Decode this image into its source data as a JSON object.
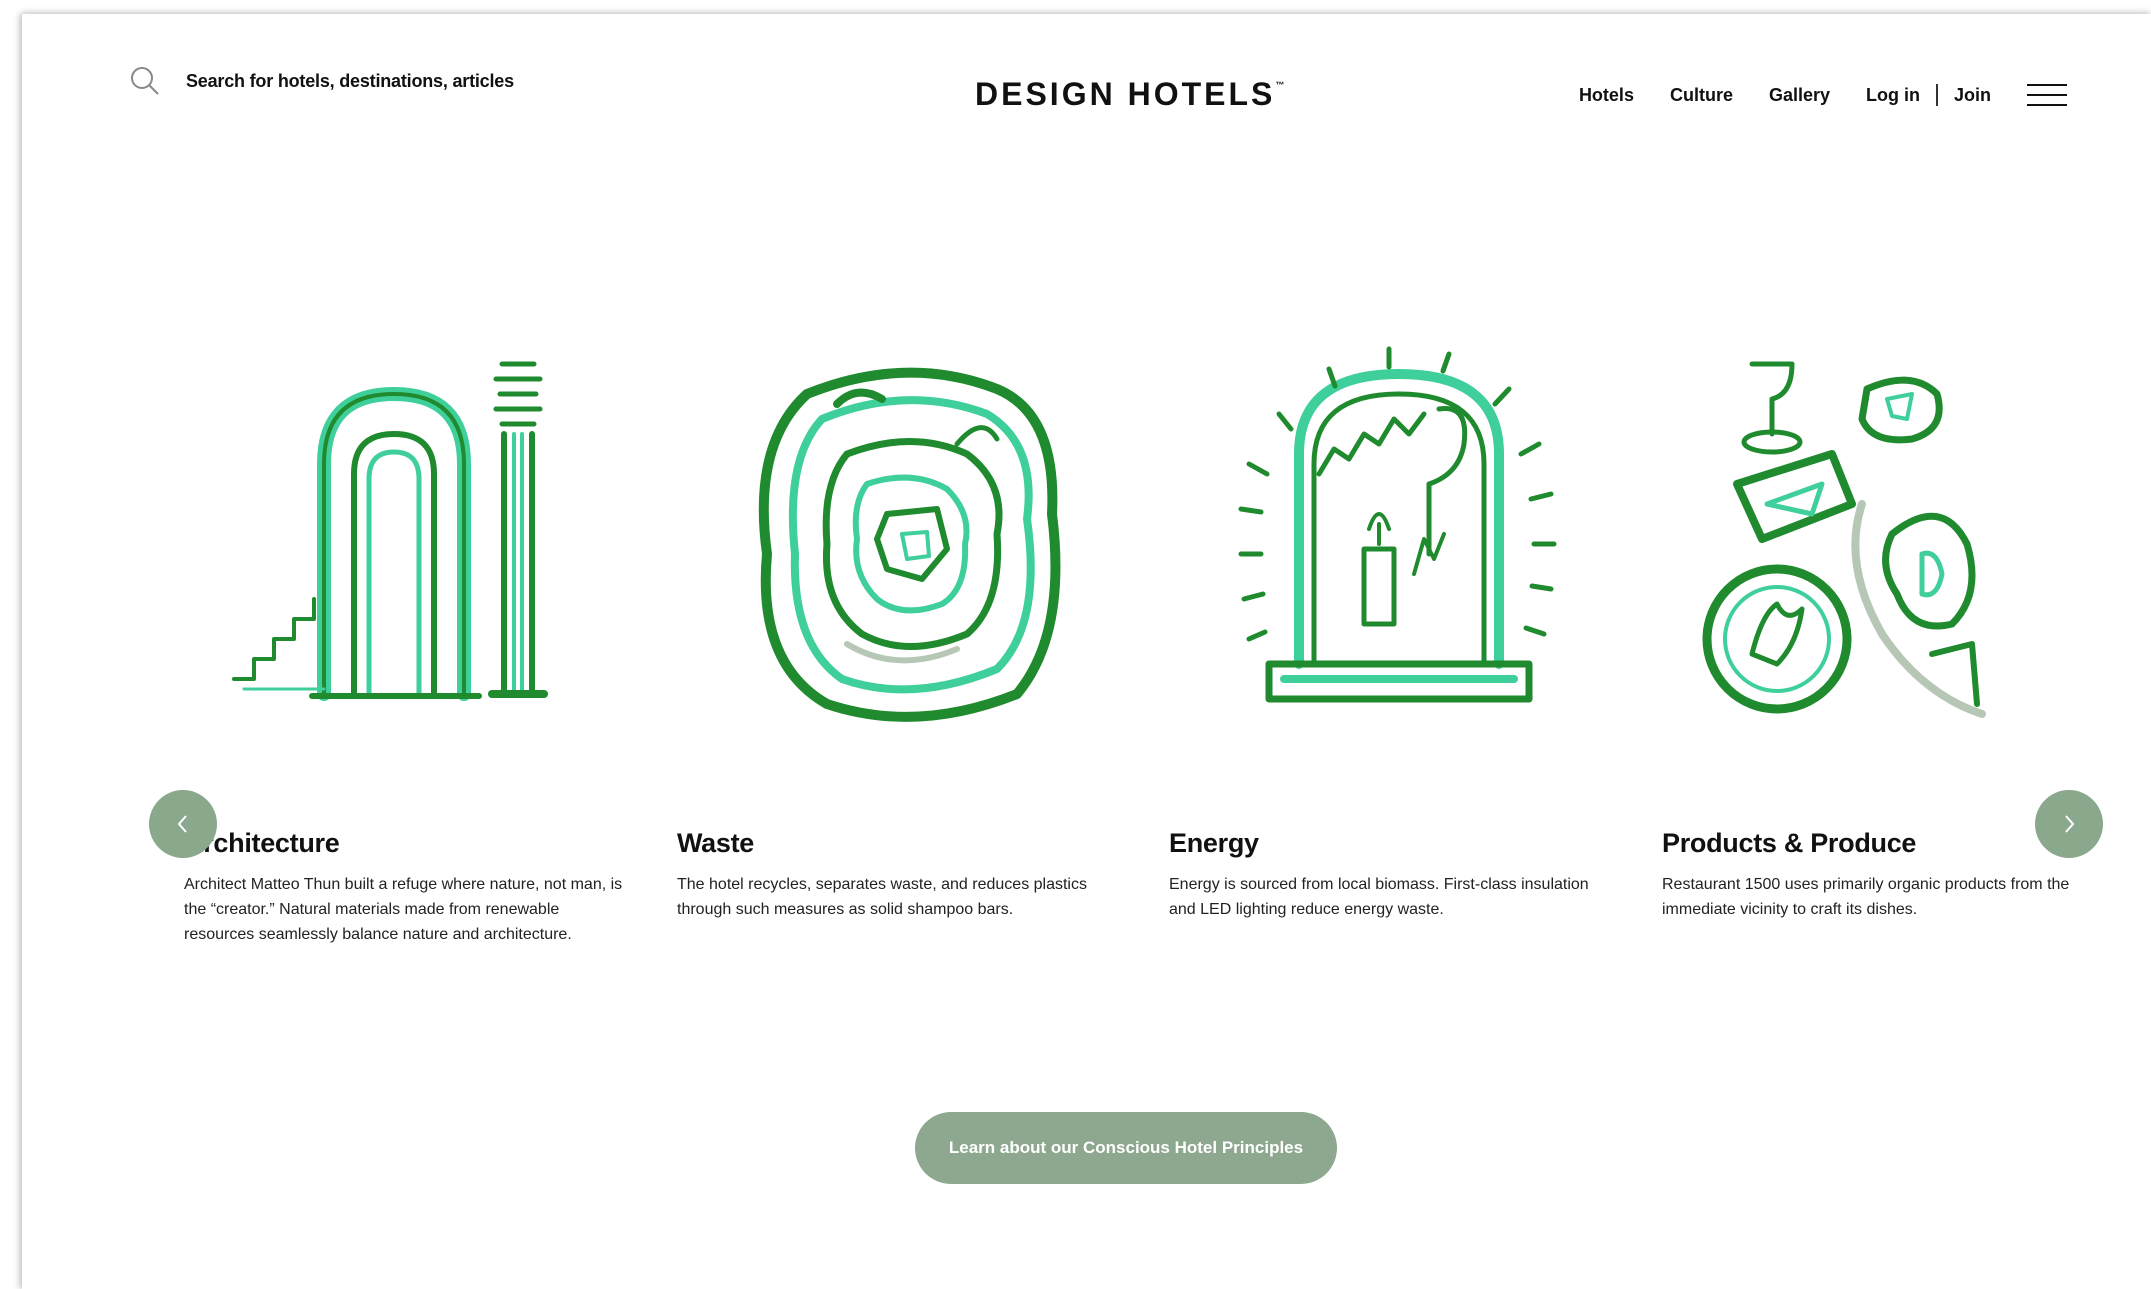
{
  "header": {
    "search_placeholder": "Search for hotels, destinations, articles",
    "logo_text": "DESIGN HOTELS",
    "logo_mark": "™",
    "nav": {
      "hotels": "Hotels",
      "culture": "Culture",
      "gallery": "Gallery",
      "login": "Log in",
      "join": "Join"
    }
  },
  "cards": [
    {
      "title": "Architecture",
      "text": "Architect Matteo Thun built a refuge where nature, not man, is the “creator.” Natural materials made from renewable resources seamlessly balance nature and architecture.",
      "icon": "arch-column-illustration"
    },
    {
      "title": "Waste",
      "text": "The hotel recycles, separates waste, and reduces plastics through such measures as solid shampoo bars.",
      "icon": "waste-swirl-illustration"
    },
    {
      "title": "Energy",
      "text": "Energy is sourced from local biomass. First-class insulation and LED lighting reduce energy waste.",
      "icon": "candle-lamp-illustration"
    },
    {
      "title": "Products & Produce",
      "text": "Restaurant 1500 uses primarily organic products from the immediate vicinity to craft its dishes.",
      "icon": "plates-produce-illustration"
    }
  ],
  "carousel": {
    "prev_icon": "chevron-left-icon",
    "next_icon": "chevron-right-icon"
  },
  "cta": {
    "label": "Learn about our Conscious Hotel Principles"
  },
  "colors": {
    "accent_green": "#8ea88f",
    "illustration_dark": "#1f8a2e",
    "illustration_mint": "#3fcf9a",
    "text": "#111111"
  }
}
